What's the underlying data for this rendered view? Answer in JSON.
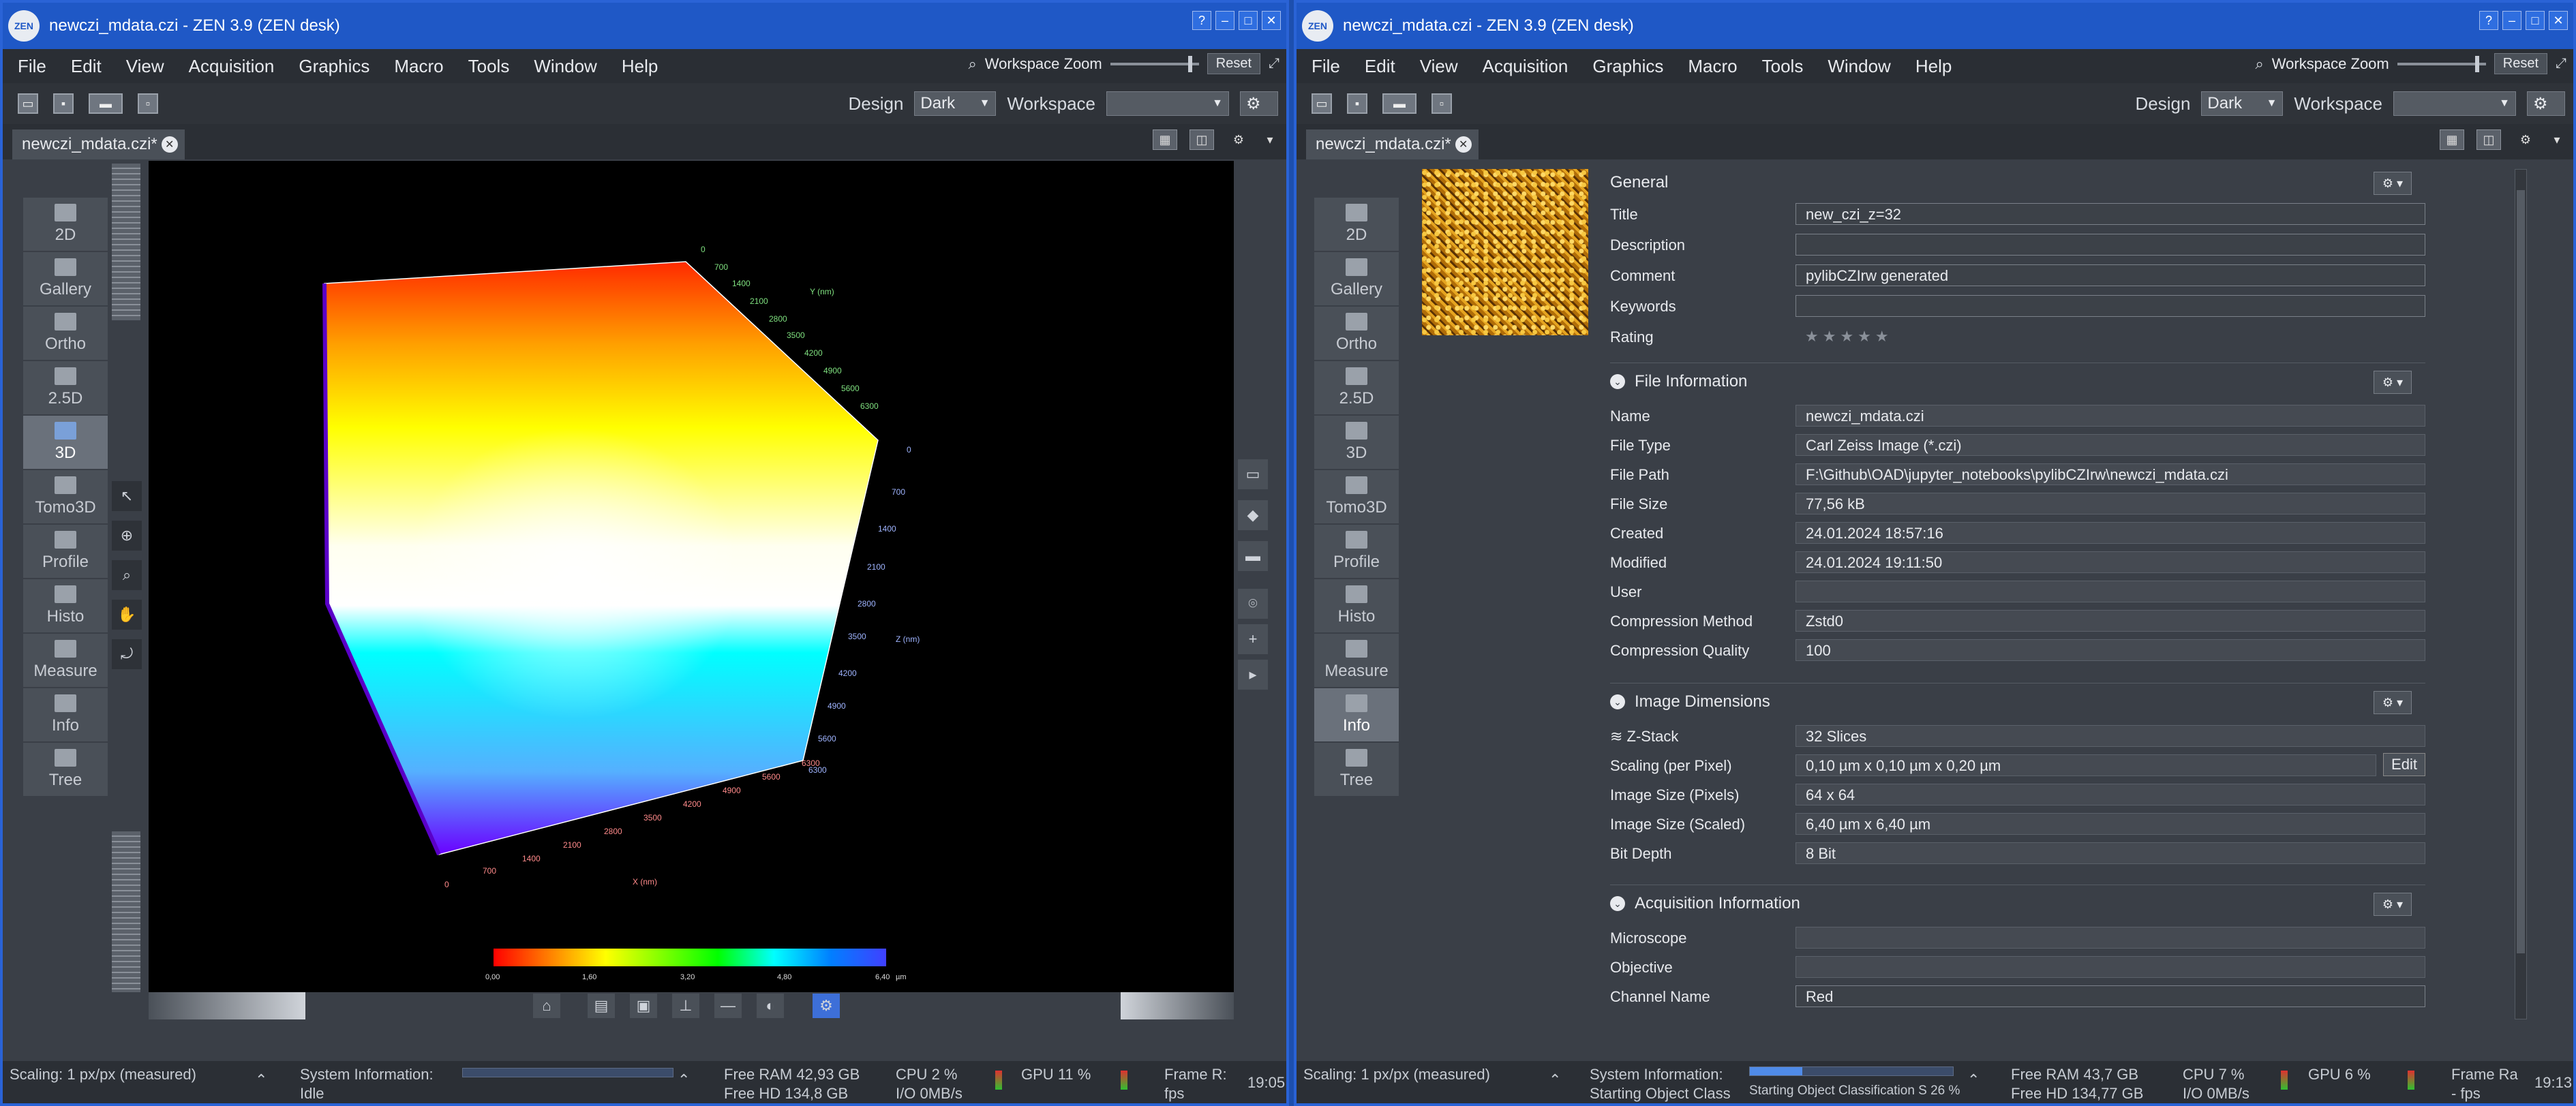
{
  "left_window": {
    "title": "newczi_mdata.czi - ZEN 3.9 (ZEN desk)",
    "menu": [
      "File",
      "Edit",
      "View",
      "Acquisition",
      "Graphics",
      "Macro",
      "Tools",
      "Window",
      "Help"
    ],
    "zoom_label": "Workspace Zoom",
    "reset_label": "Reset",
    "design_label": "Design",
    "design_value": "Dark",
    "workspace_label": "Workspace",
    "doc_tab": "newczi_mdata.czi*",
    "nav": [
      "2D",
      "Gallery",
      "Ortho",
      "2.5D",
      "3D",
      "Tomo3D",
      "Profile",
      "Histo",
      "Measure",
      "Info",
      "Tree"
    ],
    "nav_active": "3D",
    "axes": {
      "y_label": "Y (nm)",
      "z_label": "Z (nm)",
      "x_label": "X (nm)",
      "y_ticks": [
        "0",
        "700",
        "1400",
        "2100",
        "2800",
        "3500",
        "4200",
        "4900",
        "5600",
        "6300"
      ],
      "z_ticks": [
        "0",
        "700",
        "1400",
        "2100",
        "2800",
        "3500",
        "4200",
        "4900",
        "5600",
        "6300"
      ],
      "x_ticks": [
        "0",
        "700",
        "1400",
        "2100",
        "2800",
        "3500",
        "4200",
        "4900",
        "5600",
        "6300"
      ]
    },
    "colorbar_ticks": [
      "0,00",
      "1,60",
      "3,20",
      "4,80",
      "6,40"
    ],
    "colorbar_unit": "µm",
    "status": {
      "scaling_label": "Scaling:",
      "scaling_value": "1 px/px (measured)",
      "sys_label": "System Information:",
      "sys_value": "Idle",
      "free_ram_label": "Free RAM",
      "free_ram": "42,93 GB",
      "free_hd_label": "Free HD",
      "free_hd": "134,8 GB",
      "cpu_label": "CPU",
      "cpu": "2 %",
      "io_label": "I/O",
      "io": "0MB/s",
      "gpu_label": "GPU",
      "gpu": "11 %",
      "frame_label": "Frame R:",
      "frame_unit": "fps",
      "time": "19:05"
    }
  },
  "right_window": {
    "title": "newczi_mdata.czi - ZEN 3.9 (ZEN desk)",
    "menu": [
      "File",
      "Edit",
      "View",
      "Acquisition",
      "Graphics",
      "Macro",
      "Tools",
      "Window",
      "Help"
    ],
    "zoom_label": "Workspace Zoom",
    "reset_label": "Reset",
    "design_label": "Design",
    "design_value": "Dark",
    "workspace_label": "Workspace",
    "doc_tab": "newczi_mdata.czi*",
    "nav": [
      "2D",
      "Gallery",
      "Ortho",
      "2.5D",
      "3D",
      "Tomo3D",
      "Profile",
      "Histo",
      "Measure",
      "Info",
      "Tree"
    ],
    "nav_active": "Info",
    "general": {
      "heading": "General",
      "title_label": "Title",
      "title_value": "new_czi_z=32",
      "description_label": "Description",
      "description_value": "",
      "comment_label": "Comment",
      "comment_value": "pylibCZIrw generated",
      "keywords_label": "Keywords",
      "keywords_value": "",
      "rating_label": "Rating",
      "rating_value": "★★★★★"
    },
    "file_info": {
      "heading": "File Information",
      "rows": [
        {
          "k": "Name",
          "v": "newczi_mdata.czi"
        },
        {
          "k": "File Type",
          "v": "Carl Zeiss Image (*.czi)"
        },
        {
          "k": "File Path",
          "v": "F:\\Github\\OAD\\jupyter_notebooks\\pylibCZIrw\\newczi_mdata.czi"
        },
        {
          "k": "File Size",
          "v": "77,56 kB"
        },
        {
          "k": "Created",
          "v": "24.01.2024 18:57:16"
        },
        {
          "k": "Modified",
          "v": "24.01.2024 19:11:50"
        },
        {
          "k": "User",
          "v": ""
        },
        {
          "k": "Compression Method",
          "v": "Zstd0"
        },
        {
          "k": "Compression Quality",
          "v": "100"
        }
      ]
    },
    "image_dims": {
      "heading": "Image Dimensions",
      "rows": [
        {
          "k": "Z-Stack",
          "v": "32 Slices"
        },
        {
          "k": "Scaling (per Pixel)",
          "v": "0,10 µm x 0,10 µm x 0,20 µm"
        },
        {
          "k": "Image Size (Pixels)",
          "v": "64 x 64"
        },
        {
          "k": "Image Size (Scaled)",
          "v": "6,40 µm x 6,40 µm"
        },
        {
          "k": "Bit Depth",
          "v": "8 Bit"
        }
      ],
      "edit_label": "Edit"
    },
    "acq_info": {
      "heading": "Acquisition Information",
      "rows": [
        {
          "k": "Microscope",
          "v": ""
        },
        {
          "k": "Objective",
          "v": ""
        },
        {
          "k": "Channel Name",
          "v": "Red"
        }
      ]
    },
    "status": {
      "scaling_label": "Scaling:",
      "scaling_value": "1 px/px (measured)",
      "sys_label": "System Information:",
      "sys_value": "Starting Object Class",
      "progress_text": "Starting Object Classification S 26 %",
      "progress": 0.26,
      "free_ram_label": "Free RAM",
      "free_ram": "43,7 GB",
      "free_hd_label": "Free HD",
      "free_hd": "134,77 GB",
      "cpu_label": "CPU",
      "cpu": "7 %",
      "io_label": "I/O",
      "io": "0MB/s",
      "gpu_label": "GPU",
      "gpu": "6 %",
      "frame_label": "Frame Ra",
      "frame_unit": "- fps",
      "time": "19:13"
    }
  }
}
